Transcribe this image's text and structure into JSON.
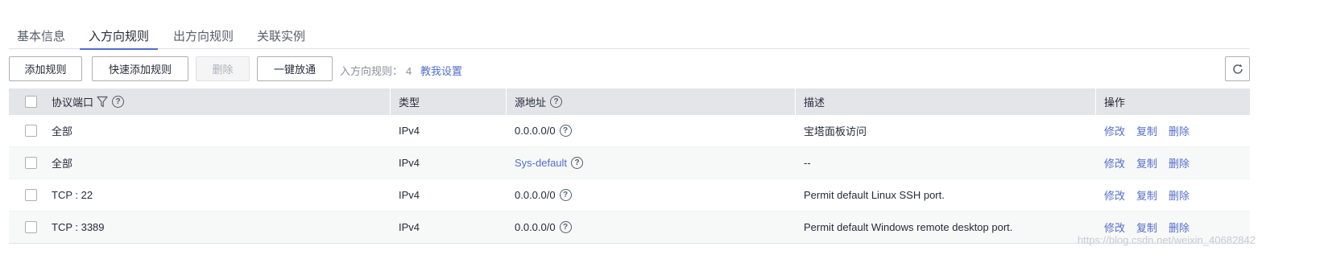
{
  "tabs": [
    {
      "label": "基本信息",
      "active": false
    },
    {
      "label": "入方向规则",
      "active": true
    },
    {
      "label": "出方向规则",
      "active": false
    },
    {
      "label": "关联实例",
      "active": false
    }
  ],
  "toolbar": {
    "add_rule": "添加规则",
    "quick_add_rule": "快速添加规则",
    "delete": "删除",
    "one_click_allow": "一键放通",
    "rule_count_label": "入方向规则：",
    "rule_count": "4",
    "teach_link": "教我设置",
    "refresh_icon": "refresh-icon"
  },
  "table": {
    "headers": {
      "protocol_port": "协议端口",
      "type": "类型",
      "source": "源地址",
      "description": "描述",
      "actions": "操作"
    },
    "rows": [
      {
        "protocol_port": "全部",
        "type": "IPv4",
        "source": "0.0.0.0/0",
        "source_is_link": false,
        "description": "宝塔面板访问"
      },
      {
        "protocol_port": "全部",
        "type": "IPv4",
        "source": "Sys-default",
        "source_is_link": true,
        "description": "--"
      },
      {
        "protocol_port": "TCP : 22",
        "type": "IPv4",
        "source": "0.0.0.0/0",
        "source_is_link": false,
        "description": "Permit default Linux SSH port."
      },
      {
        "protocol_port": "TCP : 3389",
        "type": "IPv4",
        "source": "0.0.0.0/0",
        "source_is_link": false,
        "description": "Permit default Windows remote desktop port."
      }
    ],
    "actions": {
      "modify": "修改",
      "copy": "复制",
      "delete": "删除"
    }
  },
  "watermark": "https://blog.csdn.net/weixin_40682842",
  "colors": {
    "accent": "#526ecc",
    "header_bg": "#e3e5e8",
    "border": "#adb0b8"
  }
}
